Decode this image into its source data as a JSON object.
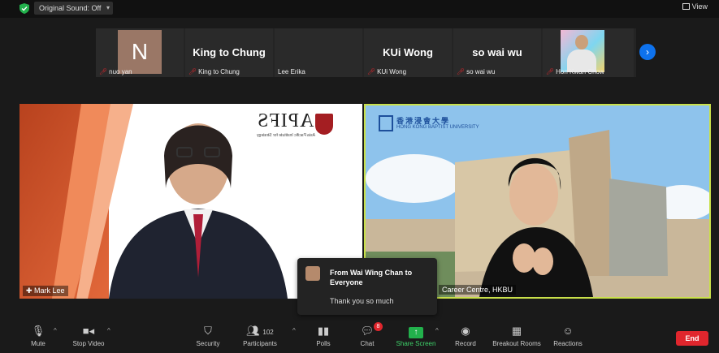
{
  "top": {
    "original_sound": "Original Sound: Off",
    "view_label": "View"
  },
  "thumbnails": [
    {
      "label": "nuo yan",
      "display": "N",
      "muted": true
    },
    {
      "label": "King to Chung",
      "display": "King to Chung",
      "muted": true
    },
    {
      "label": "Lee Erika",
      "display": "",
      "muted": false
    },
    {
      "label": "KUi Wong",
      "display": "KUi Wong",
      "muted": true
    },
    {
      "label": "so wai wu",
      "display": "so wai wu",
      "muted": true
    },
    {
      "label": "Hon Kwan Chow",
      "display": "",
      "muted": true
    }
  ],
  "main": {
    "left_name": "Mark Lee",
    "left_logo": "APIFS",
    "left_logo_sub": "Asia Pacific Institute for Strategy",
    "right_name": "Career Centre, HKBU",
    "right_logo_cn": "香港浸會大學",
    "right_logo_en": "HONG KONG BAPTIST UNIVERSITY"
  },
  "chat_popup": {
    "from": "From Wai Wing Chan to Everyone",
    "message": "Thank you so much"
  },
  "toolbar": {
    "mute": "Mute",
    "stop_video": "Stop Video",
    "security": "Security",
    "participants": "Participants",
    "participants_count": "102",
    "polls": "Polls",
    "chat": "Chat",
    "chat_badge": "8",
    "share_screen": "Share Screen",
    "record": "Record",
    "breakout_rooms": "Breakout Rooms",
    "reactions": "Reactions",
    "end": "End"
  },
  "colors": {
    "active_speaker_border": "#c9e04a",
    "share_green": "#22b14c",
    "end_red": "#e0262d",
    "accent_blue": "#0e72ed"
  }
}
